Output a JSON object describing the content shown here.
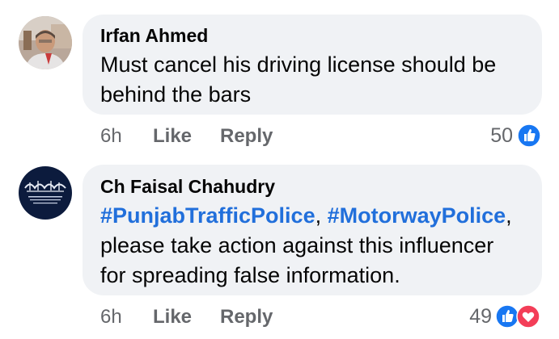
{
  "comments": [
    {
      "author": "Irfan Ahmed",
      "text": "Must cancel his driving license should be behind the bars",
      "time": "6h",
      "like_label": "Like",
      "reply_label": "Reply",
      "reaction_count": "50",
      "reactions": [
        "like-icon"
      ]
    },
    {
      "author": "Ch Faisal Chahudry",
      "hashtag1": "#PunjabTrafficPolice",
      "sep": ", ",
      "hashtag2": "#MotorwayPolice",
      "after_hashtags": ",",
      "text_line2": "please take action against this influencer",
      "text_line3": "for spreading false information.",
      "time": "6h",
      "like_label": "Like",
      "reply_label": "Reply",
      "reaction_count": "49",
      "reactions": [
        "like-icon",
        "love-icon"
      ]
    }
  ],
  "colors": {
    "bubble": "#f0f2f5",
    "hashtag": "#216fdb",
    "meta": "#65676b",
    "like": "#1877f2",
    "love": "#f33e58"
  }
}
